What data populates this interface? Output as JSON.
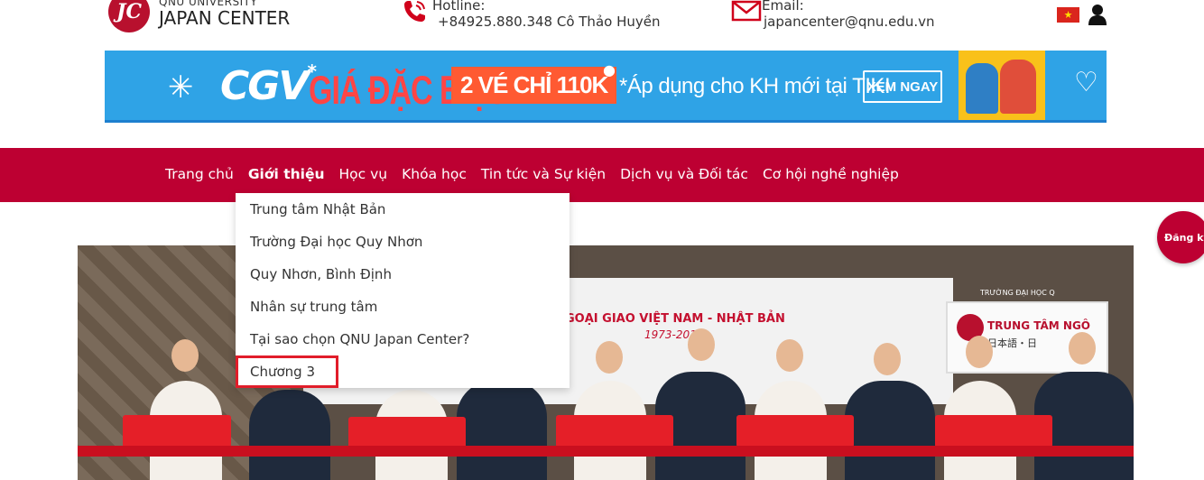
{
  "header": {
    "logo": {
      "mark": "JC",
      "subtitle": "QNU UNIVERSITY",
      "title": "JAPAN CENTER"
    },
    "hotline": {
      "label": "Hotline:",
      "value": "+84925.880.348 Cô Thảo Huyền"
    },
    "email": {
      "label": "Email:",
      "value": "japancenter@qnu.edu.vn"
    },
    "flag_icon": "vietnam-flag",
    "user_icon": "user-icon"
  },
  "banner": {
    "brand": "CGV",
    "headline": "GIÁ ĐẶC BIỆT",
    "price": "2 VÉ CHỈ 110K",
    "note": "*Áp dụng cho KH mới tại TIKI",
    "cta": "XEM NGAY"
  },
  "nav": {
    "items": [
      {
        "label": "Trang chủ"
      },
      {
        "label": "Giới thiệu"
      },
      {
        "label": "Học vụ"
      },
      {
        "label": "Khóa học"
      },
      {
        "label": "Tin tức và Sự kiện"
      },
      {
        "label": "Dịch vụ và Đối tác"
      },
      {
        "label": "Cơ hội nghề nghiệp"
      }
    ],
    "active": "Giới thiệu"
  },
  "dropdown": {
    "items": [
      {
        "label": "Trung tâm Nhật Bản"
      },
      {
        "label": "Trường Đại học Quy Nhơn"
      },
      {
        "label": "Quy Nhơn, Bình Định"
      },
      {
        "label": "Nhân sự trung tâm"
      },
      {
        "label": "Tại sao chọn QNU Japan Center?"
      },
      {
        "label": "Chương 3"
      }
    ],
    "highlighted": "Chương 3"
  },
  "hero": {
    "backdrop_title": "GOẠI GIAO VIỆT NAM - NHẬT BẢN",
    "backdrop_years": "1973-2018",
    "sign_school": "TRƯỜNG ĐẠI HỌC Q",
    "sign_title": "TRUNG TÂM NGÔ",
    "sign_sub": "日本語・日"
  },
  "register_button": "Đăng ký",
  "colors": {
    "brand_red": "#bd0032",
    "highlight_outline": "#e11d2a",
    "banner_blue": "#2fa3e6"
  }
}
